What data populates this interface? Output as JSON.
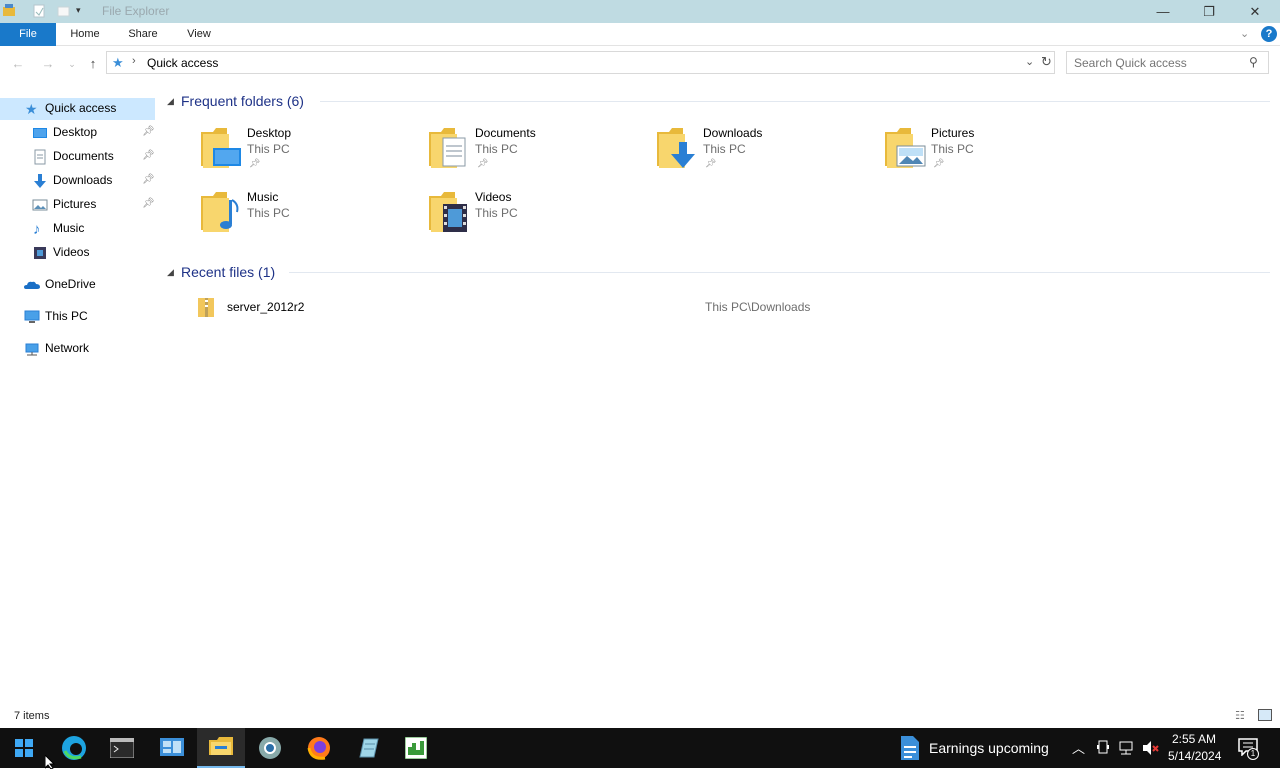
{
  "window": {
    "title": "File Explorer",
    "minimize_icon": "minimize-icon",
    "restore_icon": "restore-icon",
    "close_icon": "close-icon"
  },
  "ribbon": {
    "tabs": [
      "File",
      "Home",
      "Share",
      "View"
    ],
    "accent": "#1979ca"
  },
  "address": {
    "path": "Quick access",
    "search_placeholder": "Search Quick access"
  },
  "nav": {
    "quick_access": "Quick access",
    "pinned": [
      {
        "label": "Desktop",
        "pinned": true
      },
      {
        "label": "Documents",
        "pinned": true
      },
      {
        "label": "Downloads",
        "pinned": true
      },
      {
        "label": "Pictures",
        "pinned": true
      },
      {
        "label": "Music",
        "pinned": false
      },
      {
        "label": "Videos",
        "pinned": false
      }
    ],
    "onedrive": "OneDrive",
    "this_pc": "This PC",
    "network": "Network"
  },
  "content": {
    "frequent_header": "Frequent folders (6)",
    "recent_header": "Recent files (1)",
    "folders": [
      {
        "name": "Desktop",
        "location": "This PC",
        "pinned": true
      },
      {
        "name": "Documents",
        "location": "This PC",
        "pinned": true
      },
      {
        "name": "Downloads",
        "location": "This PC",
        "pinned": true
      },
      {
        "name": "Pictures",
        "location": "This PC",
        "pinned": true
      },
      {
        "name": "Music",
        "location": "This PC",
        "pinned": false
      },
      {
        "name": "Videos",
        "location": "This PC",
        "pinned": false
      }
    ],
    "recent": [
      {
        "name": "server_2012r2",
        "path": "This PC\\Downloads"
      }
    ]
  },
  "status": {
    "item_count": "7 items"
  },
  "taskbar": {
    "news": "Earnings upcoming",
    "time": "2:55 AM",
    "date": "5/14/2024",
    "notifications": "1"
  }
}
